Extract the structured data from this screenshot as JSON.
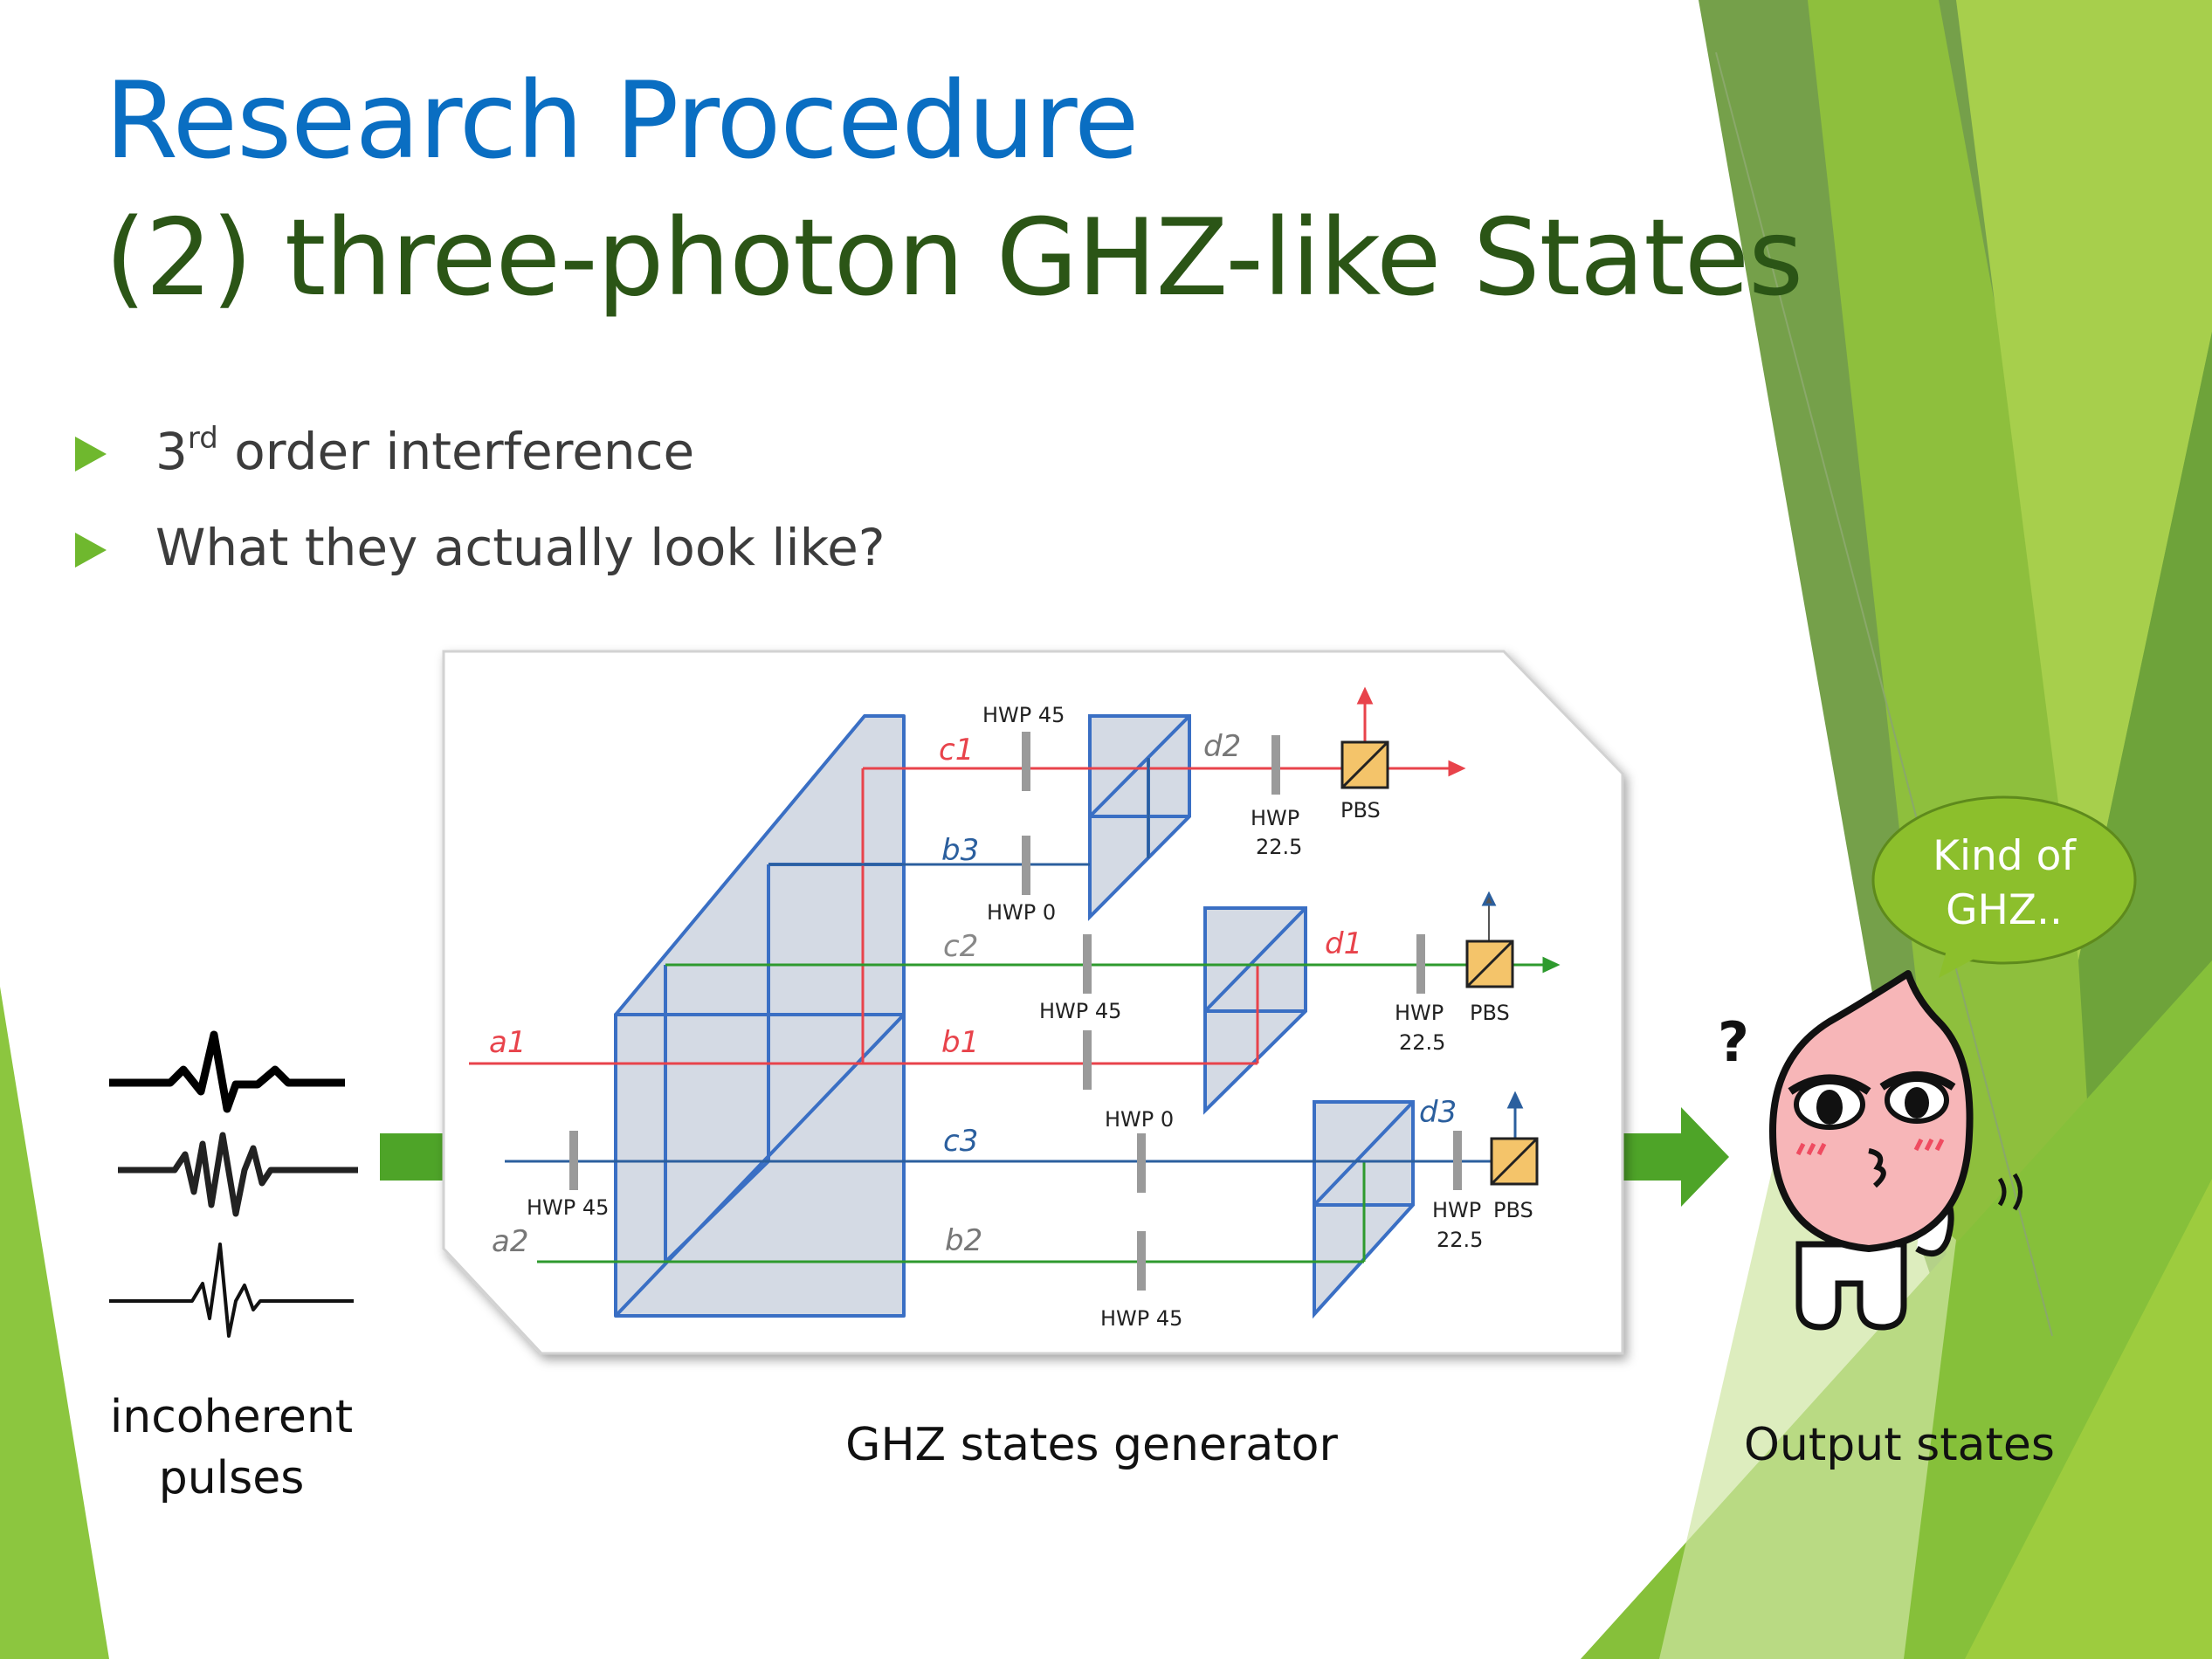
{
  "slide": {
    "title_line1": "Research Procedure",
    "title_line2": "(2) three-photon GHZ-like States",
    "bullets": [
      {
        "main": "3",
        "sup": "rd",
        "rest": " order interference"
      },
      {
        "main": "What they actually look like?"
      }
    ],
    "captions": {
      "pulses_line1": "incoherent",
      "pulses_line2": "pulses",
      "generator": "GHZ states generator",
      "output": "Output states"
    },
    "speech_bubble": {
      "line1": "Kind of",
      "line2": "GHZ.."
    },
    "question_mark": "?"
  },
  "diagram": {
    "path_labels": {
      "c1": "c1",
      "b3": "b3",
      "c2": "c2",
      "a1": "a1",
      "b1": "b1",
      "c3": "c3",
      "a2": "a2",
      "b2": "b2",
      "d1": "d1",
      "d2": "d2",
      "d3": "d3"
    },
    "components": {
      "hwp45_top": "HWP 45",
      "hwp0_top": "HWP 0",
      "hwp45_mid": "HWP 45",
      "hwp0_mid": "HWP 0",
      "hwp45_input": "HWP 45",
      "hwp45_bottom": "HWP 45",
      "hwp_d2": "HWP",
      "hwp_d2_val": "22.5",
      "pbs_d2": "PBS",
      "hwp_d1": "HWP",
      "hwp_d1_val": "22.5",
      "pbs_d1": "PBS",
      "hwp_d3": "HWP",
      "hwp_d3_val": "22.5",
      "pbs_d3": "PBS"
    }
  },
  "colors": {
    "title_blue": "#0a6ec2",
    "title_green": "#2b5516",
    "bullet_green": "#6fb82e",
    "arrow_green": "#4ea428",
    "beam_red": "#e8434b",
    "beam_green": "#2e9a2e",
    "beam_blue": "#2b5f9e",
    "prism_blue": "#3a6fc4",
    "prism_fill": "#d4dae4",
    "pbs_fill": "#f4c46a",
    "bubble_green": "#8cbf2c",
    "peach_pink": "#f7b6b8"
  },
  "icons": [
    "triangle-bullet-icon",
    "right-arrow-icon",
    "waveform-icon",
    "speech-bubble-icon",
    "peach-character-icon"
  ]
}
